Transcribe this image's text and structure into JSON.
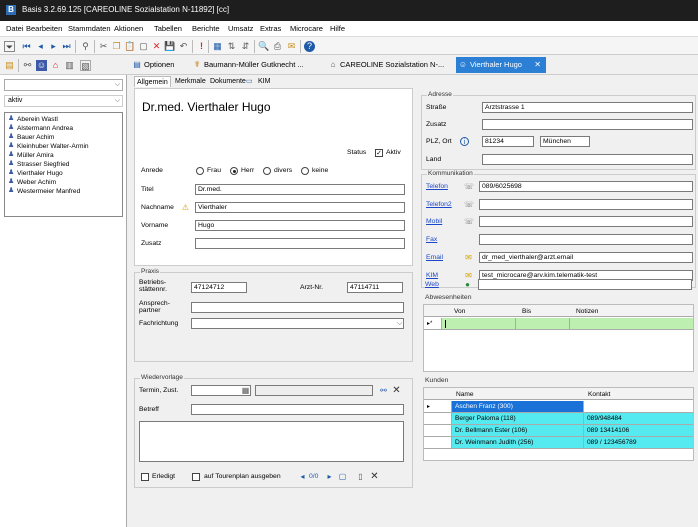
{
  "window": {
    "title": "Basis 3.2.69.125 [CAREOLINE Sozialstation N-11892] [cc]",
    "app_icon": "B"
  },
  "menu": [
    "Datei",
    "Bearbeiten",
    "Stammdaten",
    "Aktionen",
    "Tabellen",
    "Berichte",
    "Umsatz",
    "Extras",
    "Microcare",
    "Hilfe"
  ],
  "tabs": [
    {
      "label": "Optionen"
    },
    {
      "label": "Baumann-Müller Gutknecht ..."
    },
    {
      "label": "CAREOLINE Sozialstation N-..."
    },
    {
      "label": "Vierthaler Hugo",
      "active": true
    }
  ],
  "tab_close": "✕",
  "left": {
    "filter": "aktiv",
    "patients": [
      "Aberein Wastl",
      "Alstermann Andrea",
      "Bauer Achim",
      "Kleinhuber Walter-Armin",
      "Müller Amira",
      "Strasser Siegfried",
      "Vierthaler Hugo",
      "Weber Achim",
      "Westermeier Manfred"
    ]
  },
  "subtabs": [
    "Allgemein",
    "Merkmale",
    "Dokumente",
    "KIM"
  ],
  "person": {
    "display_name": "Dr.med. Vierthaler Hugo",
    "status_label": "Status",
    "status_value": "Aktiv",
    "anrede_label": "Anrede",
    "anrede_options": [
      "Frau",
      "Herr",
      "divers",
      "keine"
    ],
    "anrede_selected": "Herr",
    "titel_label": "Titel",
    "titel": "Dr.med.",
    "nachname_label": "Nachname",
    "nachname": "Vierthaler",
    "vorname_label": "Vorname",
    "vorname": "Hugo",
    "zusatz_label": "Zusatz",
    "zusatz": ""
  },
  "praxis": {
    "legend": "Praxis",
    "bsnr_label": "Betriebs-\nstättennr.",
    "bsnr": "47124712",
    "arztnr_label": "Arzt-Nr.",
    "arztnr": "47114711",
    "ansprech_label": "Ansprech-\npartner",
    "ansprech": "",
    "fach_label": "Fachrichtung",
    "fach": ""
  },
  "wiedervorlage": {
    "legend": "Wiedervorlage",
    "termin_label": "Termin, Zust.",
    "betreff_label": "Betreff",
    "erledigt_label": "Erledigt",
    "tour_label": "auf Tourenplan ausgeben",
    "counter": "0/0"
  },
  "adresse": {
    "legend": "Adresse",
    "strasse_label": "Straße",
    "strasse": "Arztstrasse 1",
    "zusatz_label": "Zusatz",
    "zusatz": "",
    "plz_label": "PLZ, Ort",
    "plz": "81234",
    "ort": "München",
    "land_label": "Land",
    "land": ""
  },
  "kommunikation": {
    "legend": "Kommunikation",
    "telefon_label": "Telefon",
    "telefon": "089/6025698",
    "telefon2_label": "Telefon2",
    "telefon2": "",
    "mobil_label": "Mobil",
    "mobil": "",
    "fax_label": "Fax",
    "fax": "",
    "email_label": "Email",
    "email": "dr_med_vierthaler@arzt.email",
    "kim_label": "KIM",
    "kim": "test_microcare@arv.kim.telematik-test",
    "web_label": "Web",
    "web": ""
  },
  "abwesenheiten": {
    "legend": "Abwesenheiten",
    "columns": [
      "Von",
      "Bis",
      "Notizen"
    ],
    "row_marker": "▸*"
  },
  "kunden": {
    "legend": "Kunden",
    "columns": [
      "Name",
      "Kontakt"
    ],
    "rows": [
      {
        "name": "Aschen Franz (300)",
        "kontakt": "",
        "selected": true
      },
      {
        "name": "Berger Paloma (118)",
        "kontakt": "089/948484"
      },
      {
        "name": "Dr. Bellmann Ester (106)",
        "kontakt": "089 13414106"
      },
      {
        "name": "Dr. Weinmann Judith (256)",
        "kontakt": "089 / 123456789"
      }
    ]
  },
  "colors": {
    "accent": "#2b7fd4",
    "kunden_row": "#55eaf0",
    "abw_row": "#bdf0b0",
    "selected_row": "#1a72d8"
  }
}
